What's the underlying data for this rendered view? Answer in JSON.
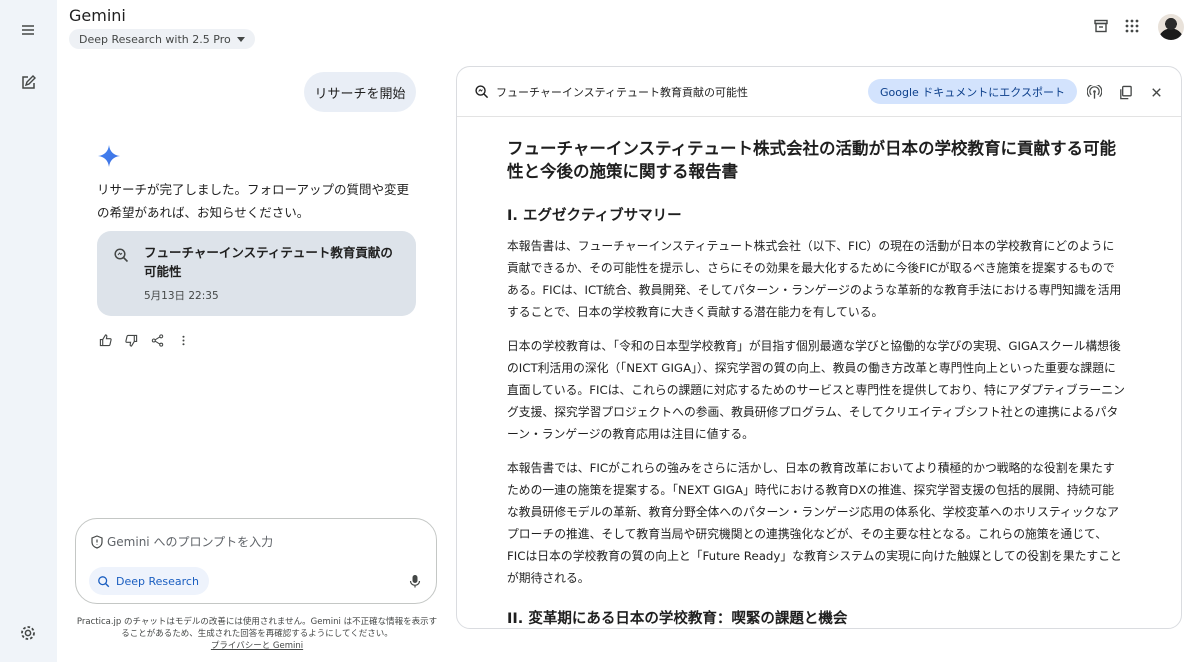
{
  "app": {
    "title": "Gemini",
    "model": "Deep Research with 2.5 Pro"
  },
  "chat": {
    "user_message": "リサーチを開始",
    "reply": "リサーチが完了しました。フォローアップの質問や変更の希望があれば、お知らせください。",
    "card": {
      "title": "フューチャーインスティテュート教育貢献の可能性",
      "date": "5月13日 22:35"
    }
  },
  "prompt": {
    "placeholder": "Gemini へのプロンプトを入力",
    "chip": "Deep Research"
  },
  "disclaimer": {
    "text": "Practica.jp のチャットはモデルの改善には使用されません。Gemini は不正確な情報を表示することがあるため、生成された回答を再確認するようにしてください。",
    "link": "プライバシーと Gemini"
  },
  "panel": {
    "title": "フューチャーインスティテュート教育貢献の可能性",
    "export_label": "Google ドキュメントにエクスポート"
  },
  "doc": {
    "title": "フューチャーインスティテュート株式会社の活動が日本の学校教育に貢献する可能性と今後の施策に関する報告書",
    "section1": "I. エグゼクティブサマリー",
    "p1": "本報告書は、フューチャーインスティテュート株式会社（以下、FIC）の現在の活動が日本の学校教育にどのように貢献できるか、その可能性を提示し、さらにその効果を最大化するために今後FICが取るべき施策を提案するものである。FICは、ICT統合、教員開発、そしてパターン・ランゲージのような革新的な教育手法における専門知識を活用することで、日本の学校教育に大きく貢献する潜在能力を有している。",
    "p2": "日本の学校教育は、「令和の日本型学校教育」が目指す個別最適な学びと協働的な学びの実現、GIGAスクール構想後のICT利活用の深化（「NEXT GIGA」）、探究学習の質の向上、教員の働き方改革と専門性向上といった重要な課題に直面している。FICは、これらの課題に対応するためのサービスと専門性を提供しており、特にアダプティブラーニング支援、探究学習プロジェクトへの参画、教員研修プログラム、そしてクリエイティブシフト社との連携によるパターン・ランゲージの教育応用は注目に値する。",
    "p3": "本報告書では、FICがこれらの強みをさらに活かし、日本の教育改革においてより積極的かつ戦略的な役割を果たすための一連の施策を提案する。「NEXT GIGA」時代における教育DXの推進、探究学習支援の包括的展開、持続可能な教員研修モデルの革新、教育分野全体へのパターン・ランゲージ応用の体系化、学校変革へのホリスティックなアプローチの推進、そして教育当局や研究機関との連携強化などが、その主要な柱となる。これらの施策を通じて、FICは日本の学校教育の質の向上と「Future Ready」な教育システムの実現に向けた触媒としての役割を果たすことが期待される。",
    "section2": "II. 変革期にある日本の学校教育：喫緊の課題と機会"
  },
  "colors": {
    "rail_bg": "#f0f4f9",
    "accent": "#1a73e8",
    "export_bg": "#d3e3fd",
    "card_bg": "#dde3ea"
  },
  "icons": [
    "menu-icon",
    "edit-icon",
    "settings-icon",
    "archive-icon",
    "apps-icon",
    "sparkle-icon",
    "deep-research-icon",
    "thumb-up-icon",
    "thumb-down-icon",
    "share-icon",
    "more-vert-icon",
    "shield-icon",
    "mic-icon",
    "podcast-icon",
    "copy-icon",
    "close-icon"
  ]
}
